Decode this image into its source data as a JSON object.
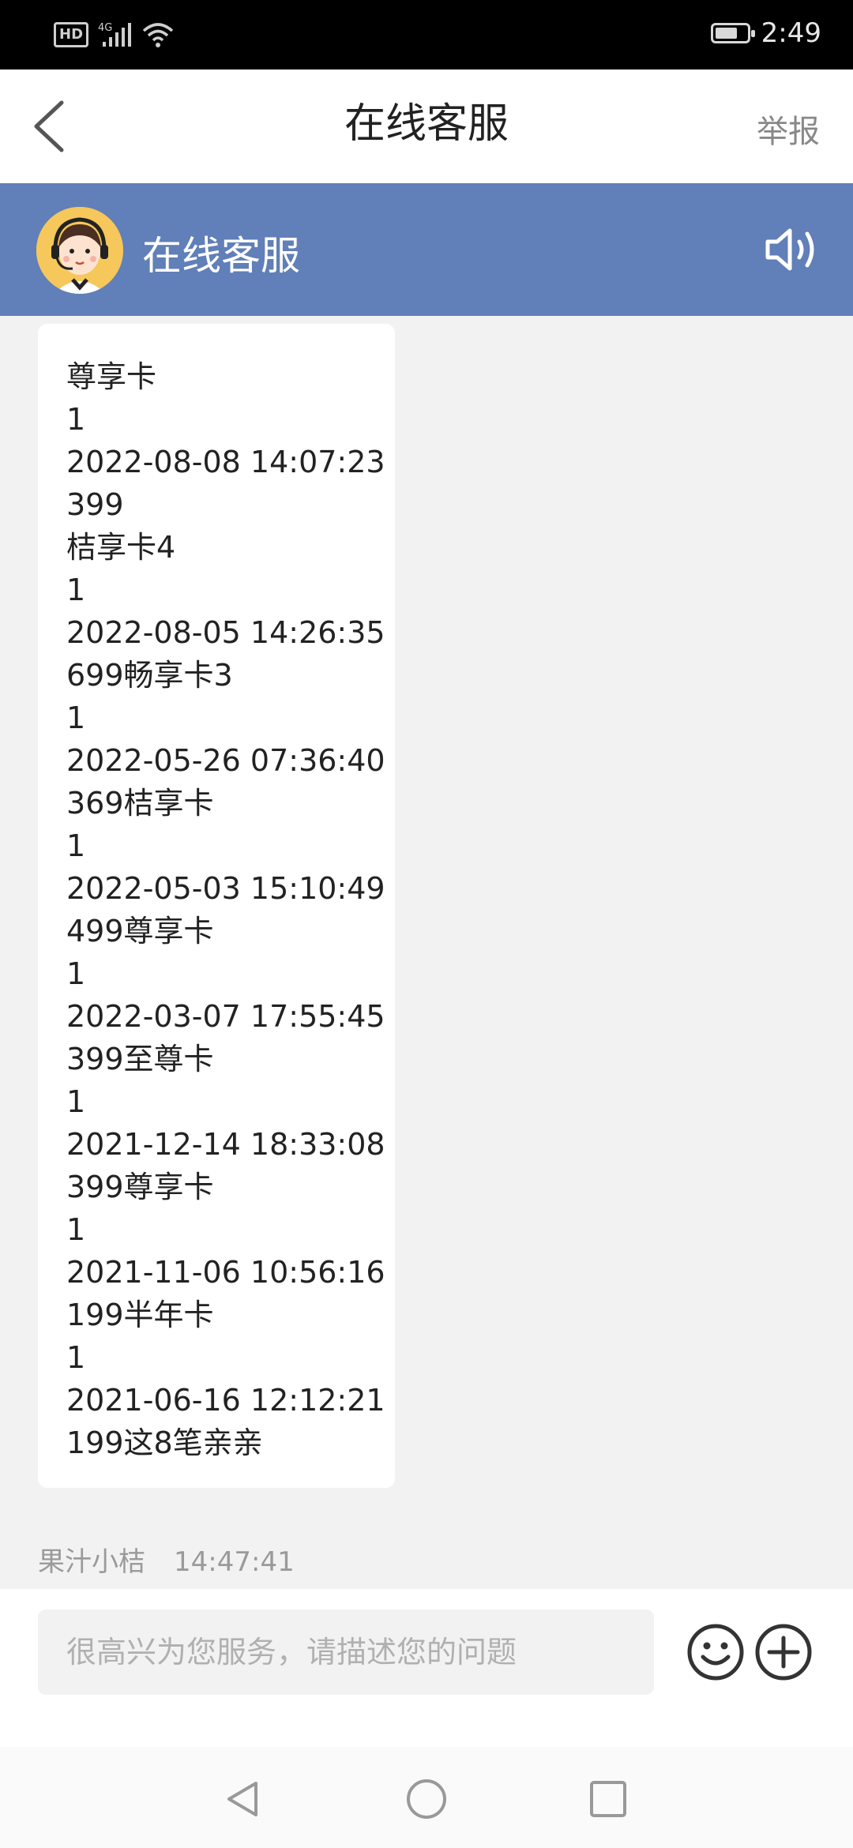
{
  "status_bar": {
    "hd_badge": "HD",
    "network": "4G",
    "time": "2:49",
    "battery_level": 0.7
  },
  "nav": {
    "title": "在线客服",
    "report_label": "举报"
  },
  "chat_header": {
    "agent_name": "在线客服"
  },
  "message": {
    "lines": [
      "尊享卡",
      "1",
      "2022-08-08 14:07:23",
      "399",
      "桔享卡4",
      "1",
      "2022-08-05 14:26:35",
      "699畅享卡3",
      "1",
      "2022-05-26 07:36:40",
      "369桔享卡",
      "1",
      "2022-05-03 15:10:49",
      "499尊享卡",
      "1",
      "2022-03-07 17:55:45",
      "399至尊卡",
      "1",
      "2021-12-14 18:33:08",
      "399尊享卡",
      "1",
      "2021-11-06 10:56:16",
      "199半年卡",
      "1",
      "2021-06-16 12:12:21",
      "199这8笔亲亲"
    ]
  },
  "next_message": {
    "sender": "果汁小桔",
    "time": "14:47:41"
  },
  "input": {
    "placeholder": "很高兴为您服务，请描述您的问题",
    "value": ""
  },
  "colors": {
    "header_bg": "#617fb8",
    "status_bar_bg": "#000000",
    "page_bg": "#f2f2f2"
  },
  "icons": [
    "back-arrow-icon",
    "avatar-icon",
    "speaker-icon",
    "emoji-icon",
    "plus-icon",
    "back-triangle-icon",
    "home-circle-icon",
    "recents-square-icon"
  ]
}
